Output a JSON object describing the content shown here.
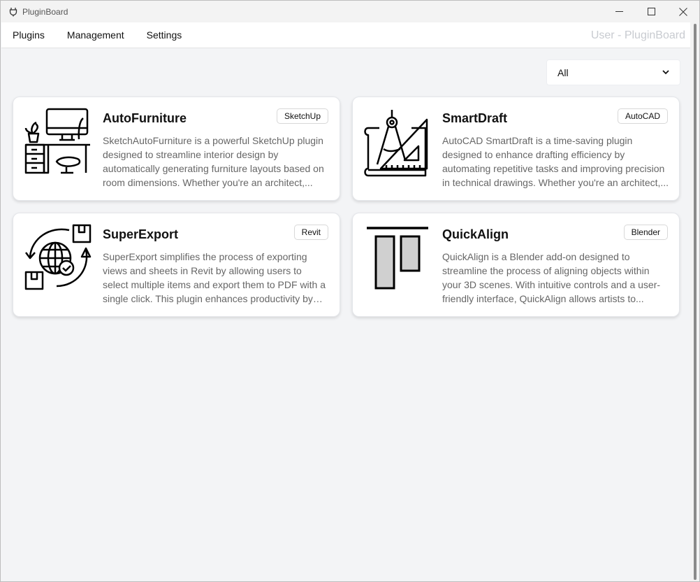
{
  "window": {
    "title": "PluginBoard"
  },
  "menu": {
    "items": [
      {
        "label": "Plugins"
      },
      {
        "label": "Management"
      },
      {
        "label": "Settings"
      }
    ],
    "user_label": "User - PluginBoard"
  },
  "filter": {
    "selected": "All"
  },
  "plugins": [
    {
      "name": "AutoFurniture",
      "tag": "SketchUp",
      "icon": "furniture-desk-icon",
      "description": "SketchAutoFurniture is a powerful SketchUp plugin designed to streamline interior design by automatically generating furniture layouts based on room dimensions. Whether you're an architect,..."
    },
    {
      "name": "SmartDraft",
      "tag": "AutoCAD",
      "icon": "drafting-compass-icon",
      "description": "AutoCAD SmartDraft is a time-saving plugin designed to enhance drafting efficiency by automating repetitive tasks and improving precision in technical drawings. Whether you're an architect,..."
    },
    {
      "name": "SuperExport",
      "tag": "Revit",
      "icon": "global-export-icon",
      "description": "SuperExport simplifies the process of exporting views and sheets in Revit by allowing users to select multiple items and export them to PDF with a single click. This plugin enhances productivity by reducin..."
    },
    {
      "name": "QuickAlign",
      "tag": "Blender",
      "icon": "align-top-icon",
      "description": "QuickAlign is a Blender add-on designed to streamline the process of aligning objects within your 3D scenes. With intuitive controls and a user-friendly interface, QuickAlign allows artists to..."
    }
  ]
}
